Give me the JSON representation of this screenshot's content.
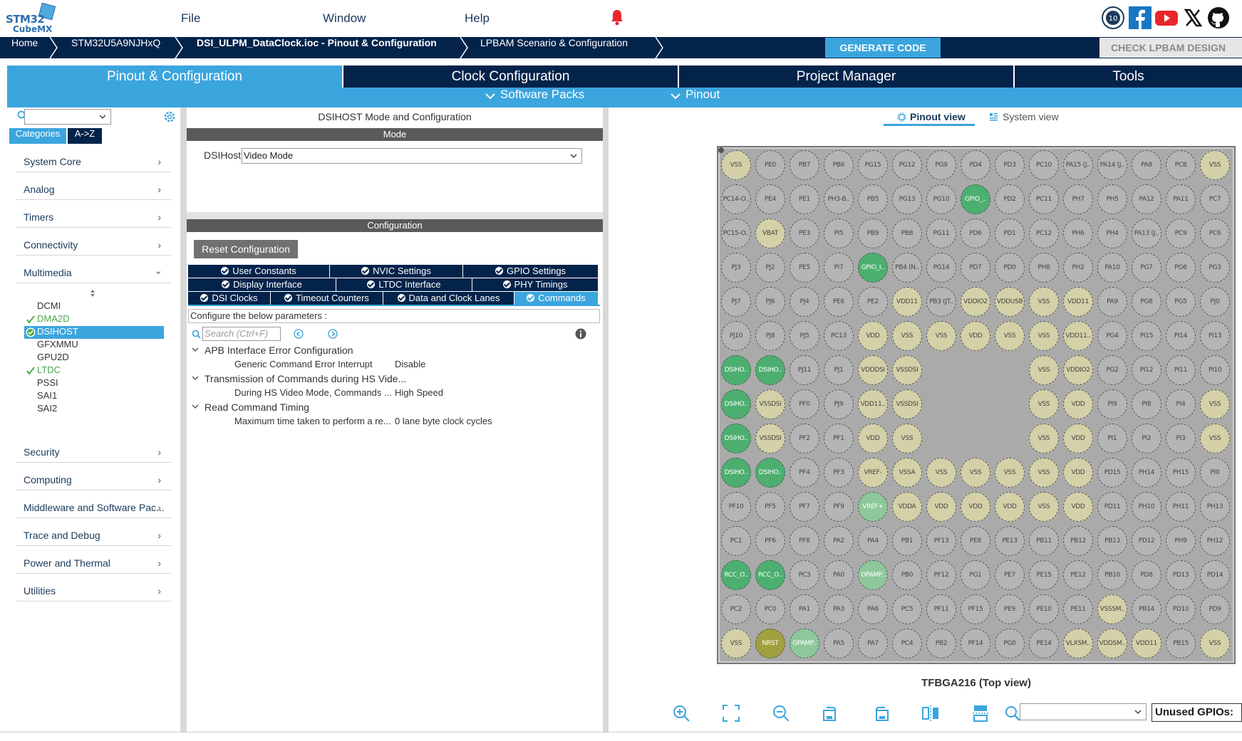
{
  "header": {
    "logo_top": "STM32",
    "logo_bottom": "CubeMX",
    "menu": {
      "file": "File",
      "window": "Window",
      "help": "Help"
    }
  },
  "breadcrumb": {
    "home": "Home",
    "device": "STM32U5A9NJHxQ",
    "project": "DSI_ULPM_DataClock.ioc - Pinout & Configuration",
    "lpbam": "LPBAM Scenario & Configuration",
    "generate": "GENERATE CODE",
    "check": "CHECK LPBAM DESIGN"
  },
  "tabs": {
    "pinout": "Pinout & Configuration",
    "clock": "Clock Configuration",
    "project": "Project Manager",
    "tools": "Tools"
  },
  "subtabs": {
    "packs": "Software Packs",
    "pinout": "Pinout"
  },
  "left": {
    "seg_categories": "Categories",
    "seg_az": "A->Z",
    "categories": [
      "System Core",
      "Analog",
      "Timers",
      "Connectivity",
      "Multimedia"
    ],
    "multimedia_items": [
      {
        "label": "DCMI",
        "state": "none"
      },
      {
        "label": "DMA2D",
        "state": "enabled"
      },
      {
        "label": "DSIHOST",
        "state": "selected"
      },
      {
        "label": "GFXMMU",
        "state": "none"
      },
      {
        "label": "GPU2D",
        "state": "none"
      },
      {
        "label": "LTDC",
        "state": "enabled"
      },
      {
        "label": "PSSI",
        "state": "none"
      },
      {
        "label": "SAI1",
        "state": "none"
      },
      {
        "label": "SAI2",
        "state": "none"
      }
    ],
    "categories_bottom": [
      "Security",
      "Computing",
      "Middleware and Software Pac...",
      "Trace and Debug",
      "Power and Thermal",
      "Utilities"
    ]
  },
  "middle": {
    "title": "DSIHOST Mode and Configuration",
    "mode_bar": "Mode",
    "dsihost_label": "DSIHost",
    "dsihost_value": "Video Mode",
    "config_bar": "Configuration",
    "reset": "Reset Configuration",
    "config_tabs_row1": [
      "User Constants",
      "NVIC Settings",
      "GPIO Settings"
    ],
    "config_tabs_row2": [
      "Display Interface",
      "LTDC Interface",
      "PHY Timings"
    ],
    "config_tabs_row3": [
      "DSI Clocks",
      "Timeout Counters",
      "Data and Clock Lanes",
      "Commands"
    ],
    "configure_text": "Configure the below parameters :",
    "search_placeholder": "Search (Ctrl+F)",
    "groups": [
      {
        "title": "APB Interface Error Configuration",
        "param": "Generic Command Error Interrupt",
        "value": "Disable"
      },
      {
        "title": "Transmission of Commands during HS Vide...",
        "param": "During HS Video Mode, Commands ...",
        "value": "High Speed"
      },
      {
        "title": "Read Command Timing",
        "param": "Maximum time taken to perform a re...",
        "value": "0 lane byte clock cycles"
      }
    ]
  },
  "right": {
    "pinout_view": "Pinout view",
    "system_view": "System view",
    "package": "TFBGA216 (Top view)",
    "unused": "Unused GPIOs:",
    "pin_rows": [
      [
        "VSS",
        "PE0",
        "PB7",
        "PB6",
        "PG15",
        "PG12",
        "PG9",
        "PD4",
        "PD3",
        "PC10",
        "PA15 (J..",
        "PA14 (J..",
        "PA8",
        "PC8",
        "VSS"
      ],
      [
        "PC14-O..",
        "PE4",
        "PE1",
        "PH3-B..",
        "PB5",
        "PG13",
        "PG10",
        "GPIO_..",
        "PD2",
        "PC11",
        "PH7",
        "PH5",
        "PA12",
        "PA11",
        "PC7"
      ],
      [
        "PC15-O..",
        "VBAT",
        "PE3",
        "PI5",
        "PB9",
        "PB8",
        "PG11",
        "PD6",
        "PD1",
        "PC12",
        "PH6",
        "PH4",
        "PA13 (J..",
        "PC9",
        "PC6"
      ],
      [
        "PJ3",
        "PJ2",
        "PE5",
        "PI7",
        "GPIO_I..",
        "PB4 (N..",
        "PG14",
        "PD7",
        "PD0",
        "PH8",
        "PH2",
        "PA10",
        "PG7",
        "PG6",
        "PG3"
      ],
      [
        "PJ7",
        "PJ6",
        "PJ4",
        "PE6",
        "PE2",
        "VDD11",
        "PB3 (JT..",
        "VDDIO2",
        "VDDUSB",
        "VSS",
        "VDD11",
        "PA9",
        "PG8",
        "PG5",
        "PJ0"
      ],
      [
        "PJ10",
        "PJ8",
        "PJ5",
        "PC13",
        "VDD",
        "VSS",
        "VSS",
        "VDD",
        "VSS",
        "VSS",
        "VDD11..",
        "PG4",
        "PI15",
        "PI14",
        "PI13"
      ],
      [
        "DSIHO..",
        "DSIHO..",
        "PJ11",
        "PJ1",
        "VDDDSI",
        "VSSDSI",
        "",
        "",
        "",
        "VSS",
        "VDDIO2",
        "PG2",
        "PI12",
        "PI11",
        "PI10"
      ],
      [
        "DSIHO..",
        "VSSDSI",
        "PF0",
        "PJ9",
        "VDD11..",
        "VSSDSI",
        "",
        "",
        "",
        "VSS",
        "VDD",
        "PI9",
        "PI8",
        "PI4",
        "VSS"
      ],
      [
        "DSIHO..",
        "VSSDSI",
        "PF2",
        "PF1",
        "VDD",
        "VSS",
        "",
        "",
        "",
        "VSS",
        "VDD",
        "PI1",
        "PI2",
        "PI3",
        "VSS"
      ],
      [
        "DSIHO..",
        "DSIHO..",
        "PF4",
        "PF3",
        "VREF-",
        "VSSA",
        "VSS",
        "VSS",
        "VSS",
        "VSS",
        "VDD",
        "PD15",
        "PH14",
        "PH15",
        "PI0"
      ],
      [
        "PF10",
        "PF5",
        "PF7",
        "PF9",
        "VREF+",
        "VDDA",
        "VDD",
        "VDD",
        "VDD",
        "VSS",
        "VDD",
        "PD11",
        "PH10",
        "PH11",
        "PH13"
      ],
      [
        "PC1",
        "PF6",
        "PF8",
        "PA2",
        "PA4",
        "PB1",
        "PF13",
        "PE8",
        "PE13",
        "PB11",
        "PB12",
        "PB13",
        "PD12",
        "PH9",
        "PH12"
      ],
      [
        "RCC_O..",
        "RCC_O..",
        "PC3",
        "PA0",
        "OPAMP..",
        "PB0",
        "PF12",
        "PG1",
        "PE7",
        "PE15",
        "PE12",
        "PB10",
        "PD8",
        "PD13",
        "PD14"
      ],
      [
        "PC2",
        "PC0",
        "PA1",
        "PA3",
        "PA6",
        "PC5",
        "PF11",
        "PF15",
        "PE9",
        "PE10",
        "PE11",
        "VSSSM..",
        "PB14",
        "PD10",
        "PD9"
      ],
      [
        "VSS",
        "NRST",
        "OPAMP..",
        "PA5",
        "PA7",
        "PC4",
        "PB2",
        "PF14",
        "PG0",
        "PE14",
        "VLXSM..",
        "VDDSM..",
        "VDD11",
        "PB15",
        "VSS"
      ]
    ]
  }
}
